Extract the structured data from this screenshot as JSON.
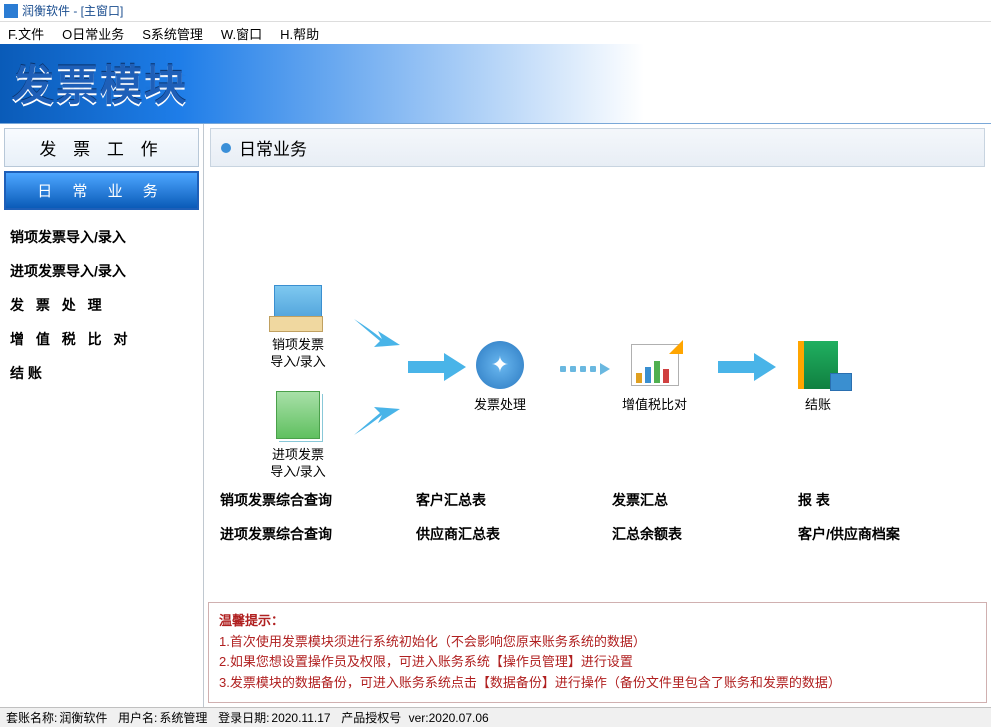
{
  "title": "润衡软件 - [主窗口]",
  "menu": {
    "file": "F.文件",
    "daily": "O日常业务",
    "system": "S系统管理",
    "window": "W.窗口",
    "help": "H.帮助"
  },
  "banner": "发票模块",
  "sidebar": {
    "header": "发 票 工 作",
    "active": "日 常 业 务",
    "items": [
      "销项发票导入/录入",
      "进项发票导入/录入",
      "发 票 处 理",
      "增 值 税 比 对",
      "结        账"
    ]
  },
  "content": {
    "header": "日常业务"
  },
  "workflow": {
    "sales": "销项发票\n导入/录入",
    "purchase": "进项发票\n导入/录入",
    "process": "发票处理",
    "vat": "增值税比对",
    "close": "结账"
  },
  "links": {
    "r1c1": "销项发票综合查询",
    "r1c2": "客户汇总表",
    "r1c3": "发票汇总",
    "r1c4": "报      表",
    "r2c1": "进项发票综合查询",
    "r2c2": "供应商汇总表",
    "r2c3": "汇总余额表",
    "r2c4": "客户/供应商档案"
  },
  "tips": {
    "title": "温馨提示：",
    "l1": "1.首次使用发票模块须进行系统初始化（不会影响您原来账务系统的数据）",
    "l2": "2.如果您想设置操作员及权限，可进入账务系统【操作员管理】进行设置",
    "l3": "3.发票模块的数据备份，可进入账务系统点击【数据备份】进行操作（备份文件里包含了账务和发票的数据）"
  },
  "status": {
    "account_label": "套账名称:",
    "account": "润衡软件",
    "user_label": "用户名:",
    "user": "系统管理",
    "date_label": "登录日期:",
    "date": "2020.11.17",
    "lic_label": "产品授权号",
    "lic": "ver:2020.07.06"
  }
}
